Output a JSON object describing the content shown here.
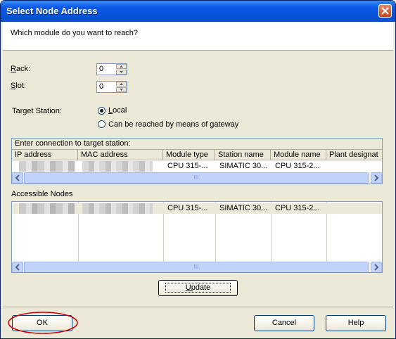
{
  "window": {
    "title": "Select Node Address"
  },
  "header": {
    "question": "Which module do you want to reach?"
  },
  "rack": {
    "label_u": "R",
    "label_rest": "ack:",
    "value": "0"
  },
  "slot": {
    "label_u": "S",
    "label_rest": "lot:",
    "value": "0"
  },
  "target_station": {
    "label": "Target Station:",
    "options": [
      {
        "label_u": "L",
        "label_rest": "ocal",
        "selected": true
      },
      {
        "label": "Can be reached by means of gateway",
        "selected": false
      }
    ]
  },
  "connection_grid": {
    "caption": "Enter connection to target station:",
    "columns": [
      "IP address",
      "MAC address",
      "Module type",
      "Station name",
      "Module name",
      "Plant designat"
    ],
    "rows": [
      {
        "module_type": "CPU 315-...",
        "station_name": "SIMATIC 30...",
        "module_name": "CPU 315-2..."
      }
    ],
    "scroll_grip": "III"
  },
  "accessible_nodes": {
    "label": "Accessible Nodes",
    "rows": [
      {
        "module_type": "CPU 315-...",
        "station_name": "SIMATIC 30...",
        "module_name": "CPU 315-2..."
      }
    ],
    "scroll_grip": "III"
  },
  "buttons": {
    "update_u": "U",
    "update_rest": "pdate",
    "ok": "OK",
    "cancel": "Cancel",
    "help": "Help"
  },
  "colors": {
    "title_bar": "#0a4ccd",
    "highlight_circle": "#cc0000",
    "window_bg": "#ece9d8"
  }
}
